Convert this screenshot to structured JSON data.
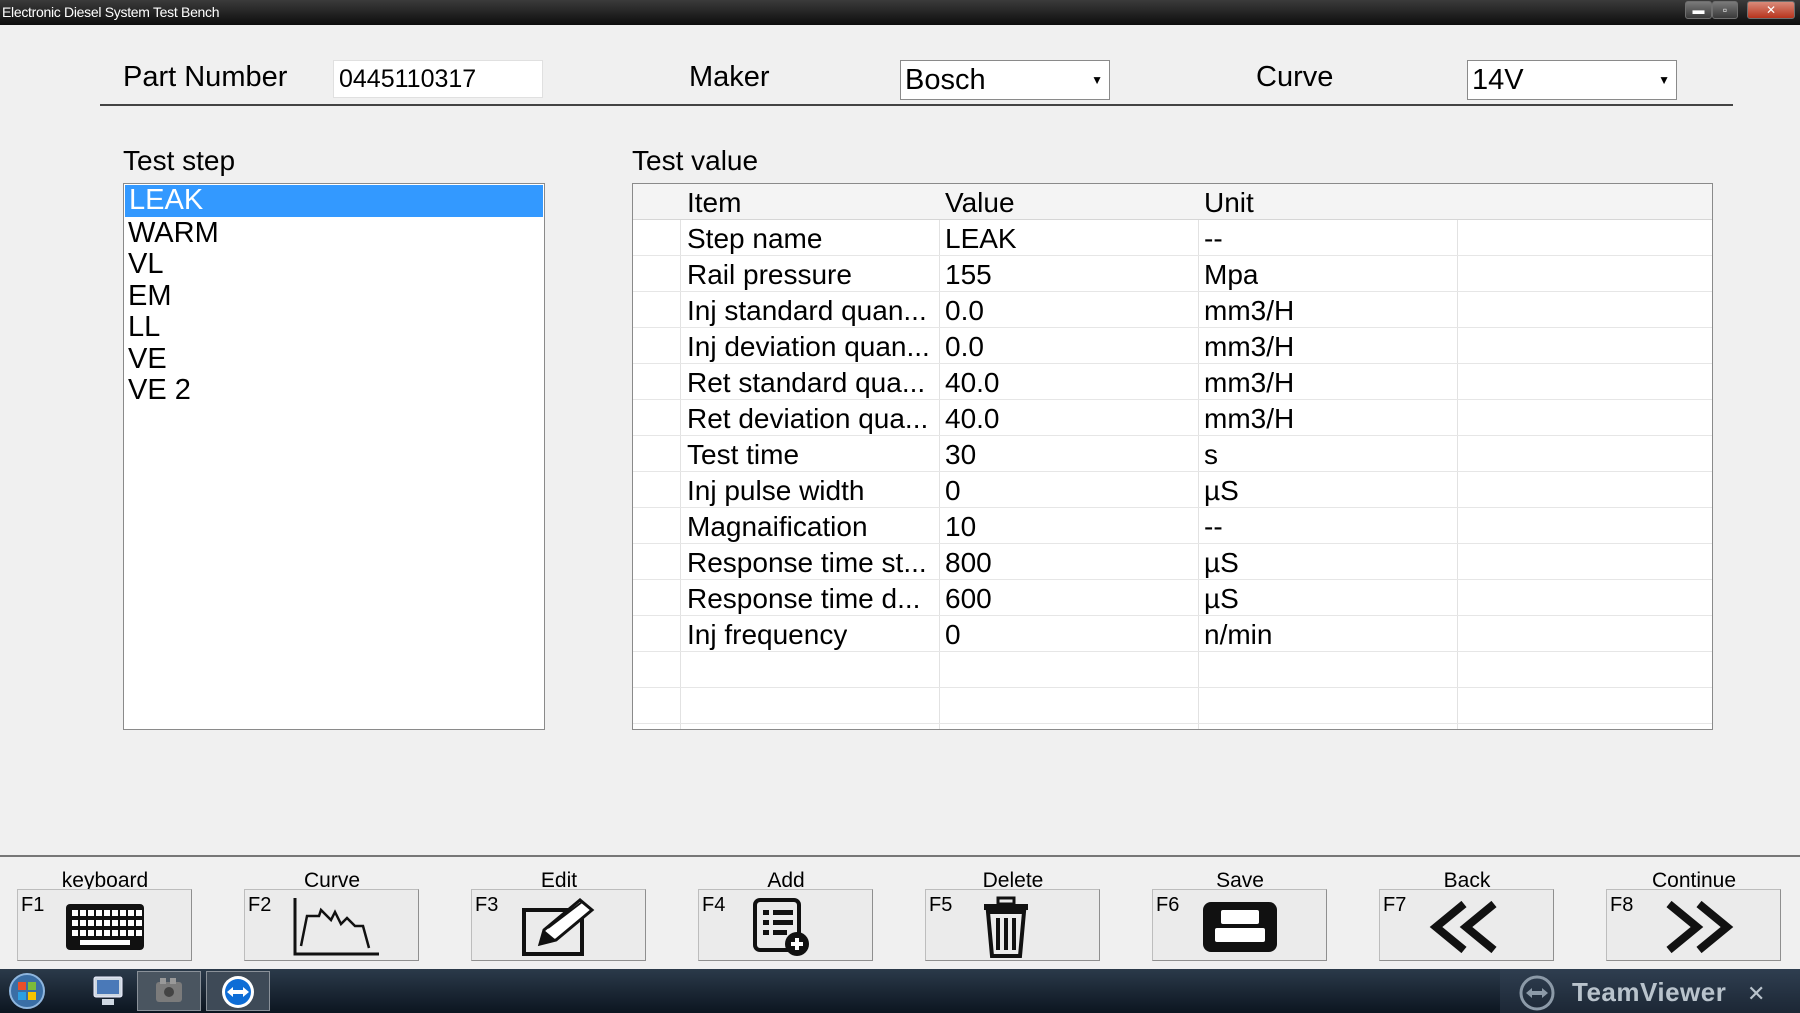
{
  "window": {
    "title": "Electronic Diesel System Test Bench",
    "min": "▬",
    "max": "▫",
    "close": "✕"
  },
  "header": {
    "part_number_label": "Part Number",
    "part_number_value": "0445110317",
    "maker_label": "Maker",
    "maker_value": "Bosch",
    "curve_label": "Curve",
    "curve_value": "14V"
  },
  "test_step": {
    "label": "Test step",
    "items": [
      "LEAK",
      "WARM",
      "VL",
      "EM",
      "LL",
      "VE",
      "VE 2"
    ],
    "selected": "LEAK"
  },
  "test_value": {
    "label": "Test value",
    "columns": [
      "Item",
      "Value",
      "Unit"
    ],
    "rows": [
      [
        "Step name",
        "LEAK",
        "--"
      ],
      [
        "Rail pressure",
        "155",
        "Mpa"
      ],
      [
        "Inj standard quan...",
        "0.0",
        "mm3/H"
      ],
      [
        "Inj deviation quan...",
        "0.0",
        "mm3/H"
      ],
      [
        "Ret standard qua...",
        "40.0",
        "mm3/H"
      ],
      [
        "Ret deviation qua...",
        "40.0",
        "mm3/H"
      ],
      [
        "Test time",
        "30",
        "s"
      ],
      [
        "Inj pulse width",
        "0",
        "µS"
      ],
      [
        "Magnaification",
        "10",
        "--"
      ],
      [
        "Response time st...",
        "800",
        "µS"
      ],
      [
        "Response time d...",
        "600",
        "µS"
      ],
      [
        "Inj frequency",
        "0",
        "n/min"
      ]
    ]
  },
  "function_keys": [
    {
      "key": "F1",
      "label": "keyboard",
      "icon": "keyboard-icon"
    },
    {
      "key": "F2",
      "label": "Curve",
      "icon": "curve-icon"
    },
    {
      "key": "F3",
      "label": "Edit",
      "icon": "edit-icon"
    },
    {
      "key": "F4",
      "label": "Add",
      "icon": "add-list-icon"
    },
    {
      "key": "F5",
      "label": "Delete",
      "icon": "trash-icon"
    },
    {
      "key": "F6",
      "label": "Save",
      "icon": "save-icon"
    },
    {
      "key": "F7",
      "label": "Back",
      "icon": "double-left-icon"
    },
    {
      "key": "F8",
      "label": "Continue",
      "icon": "double-right-icon"
    }
  ],
  "taskbar": {
    "teamviewer_label": "TeamViewer",
    "close": "✕"
  }
}
